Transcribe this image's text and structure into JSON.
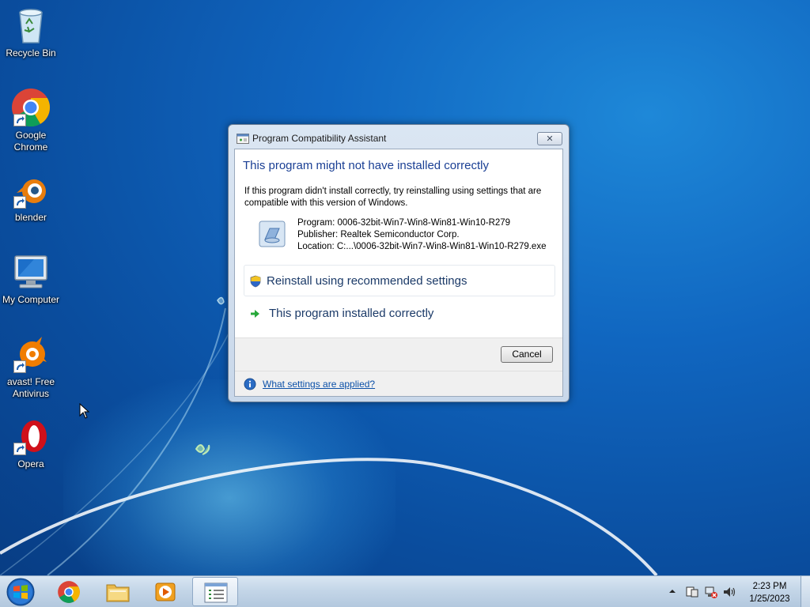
{
  "desktop": {
    "icons": [
      {
        "label": "Recycle Bin"
      },
      {
        "label": "Google Chrome"
      },
      {
        "label": "blender"
      },
      {
        "label": "My Computer"
      },
      {
        "label": "avast! Free Antivirus"
      },
      {
        "label": "Opera"
      }
    ]
  },
  "dialog": {
    "title": "Program Compatibility Assistant",
    "close_label": "✕",
    "heading": "This program might not have installed correctly",
    "description": "If this program didn't install correctly, try reinstalling using settings that are compatible with this version of Windows.",
    "program_line": "Program: 0006-32bit-Win7-Win8-Win81-Win10-R279",
    "publisher_line": "Publisher: Realtek Semiconductor Corp.",
    "location_line": "Location: C:...\\0006-32bit-Win7-Win8-Win81-Win10-R279.exe",
    "option_reinstall": "Reinstall using recommended settings",
    "option_correct": "This program installed correctly",
    "cancel_label": "Cancel",
    "settings_link": "What settings are applied?"
  },
  "taskbar": {
    "time": "2:23 PM",
    "date": "1/25/2023"
  },
  "colors": {
    "heading": "#1a3f94",
    "link": "#0b50a8",
    "desktop_blue": "#1066c0"
  }
}
